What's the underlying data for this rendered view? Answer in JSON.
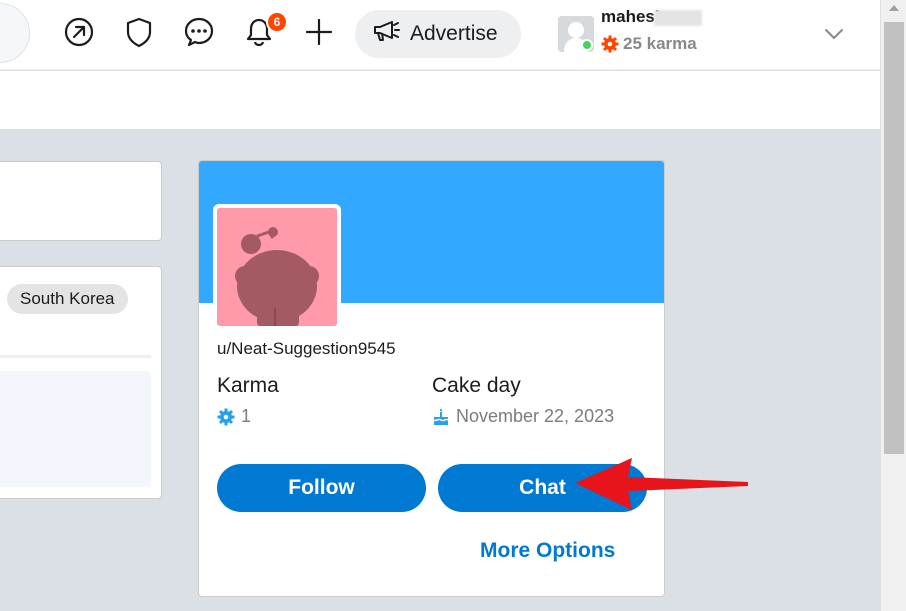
{
  "header": {
    "notification_count": "6",
    "advertise_label": "Advertise",
    "user": {
      "name": "mahesh",
      "karma": "25 karma"
    },
    "icons": [
      "popular-icon",
      "shield-icon",
      "chat-bubble-icon",
      "bell-icon",
      "plus-icon",
      "megaphone-icon",
      "chevron-down-icon"
    ]
  },
  "left": {
    "tag": "South Korea"
  },
  "profile": {
    "username": "u/Neat-Suggestion9545",
    "karma_label": "Karma",
    "karma_value": "1",
    "cakeday_label": "Cake day",
    "cakeday_value": "November 22, 2023",
    "follow_label": "Follow",
    "chat_label": "Chat",
    "more_options_label": "More Options"
  },
  "colors": {
    "banner": "#33a8ff",
    "button": "#0079d3",
    "badge": "#ff4500",
    "annotation_arrow": "#e8141b",
    "avatar_bg": "#ff9aab"
  }
}
